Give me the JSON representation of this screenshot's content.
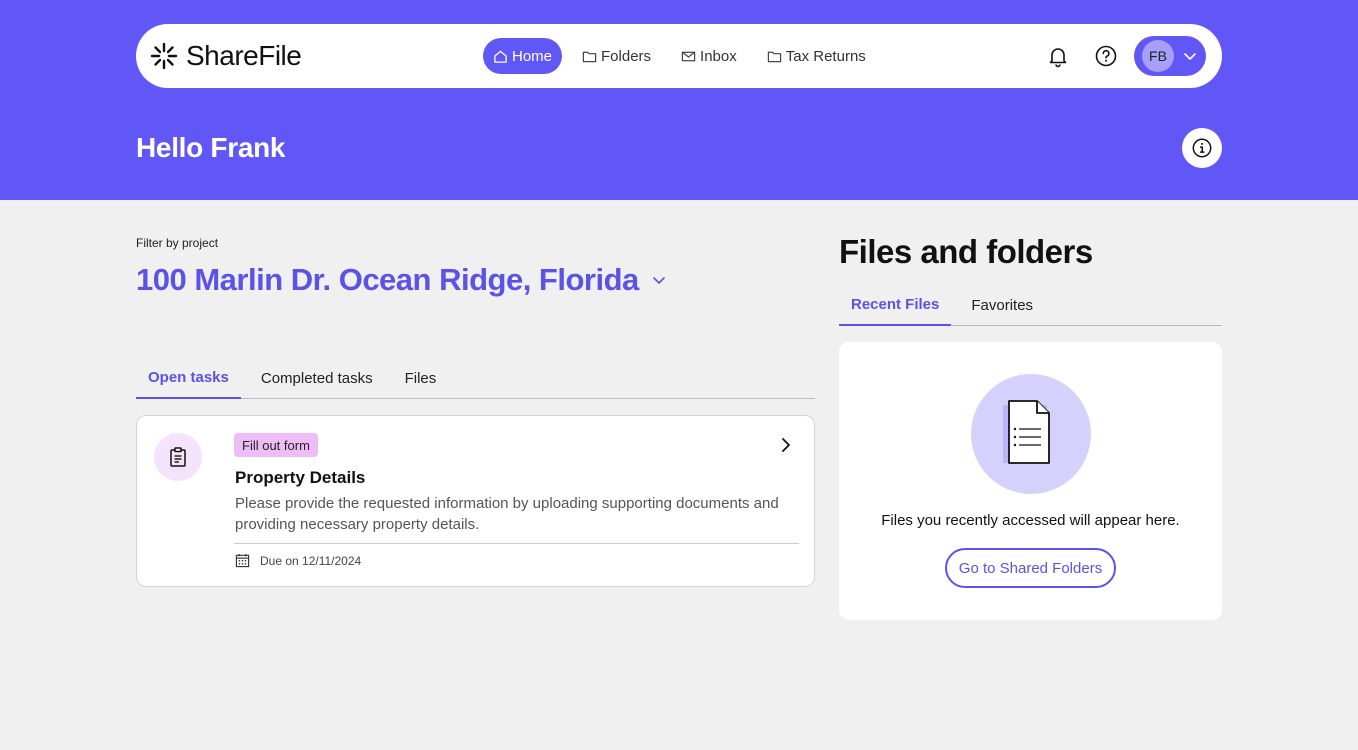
{
  "app": {
    "name": "ShareFile"
  },
  "nav": {
    "items": [
      {
        "label": "Home",
        "icon": "home-icon",
        "active": true
      },
      {
        "label": "Folders",
        "icon": "folder-icon",
        "active": false
      },
      {
        "label": "Inbox",
        "icon": "mail-icon",
        "active": false
      },
      {
        "label": "Tax Returns",
        "icon": "folder-icon",
        "active": false
      }
    ]
  },
  "user": {
    "initials": "FB"
  },
  "header": {
    "greeting": "Hello Frank"
  },
  "project": {
    "filter_label": "Filter by project",
    "selected": "100 Marlin Dr. Ocean Ridge, Florida"
  },
  "task_tabs": [
    {
      "label": "Open tasks",
      "active": true
    },
    {
      "label": "Completed tasks",
      "active": false
    },
    {
      "label": "Files",
      "active": false
    }
  ],
  "tasks": [
    {
      "badge": "Fill out form",
      "title": "Property Details",
      "description": "Please provide the requested information by uploading supporting documents and providing necessary property details.",
      "due": "Due on 12/11/2024"
    }
  ],
  "files_panel": {
    "title": "Files and folders",
    "tabs": [
      {
        "label": "Recent Files",
        "active": true
      },
      {
        "label": "Favorites",
        "active": false
      }
    ],
    "empty_text": "Files you recently accessed will appear here.",
    "button_label": "Go to Shared Folders"
  },
  "colors": {
    "brand": "#6157f7",
    "accent_text": "#5b52e8",
    "badge": "#eebcf6",
    "background": "#f0f0f0"
  }
}
